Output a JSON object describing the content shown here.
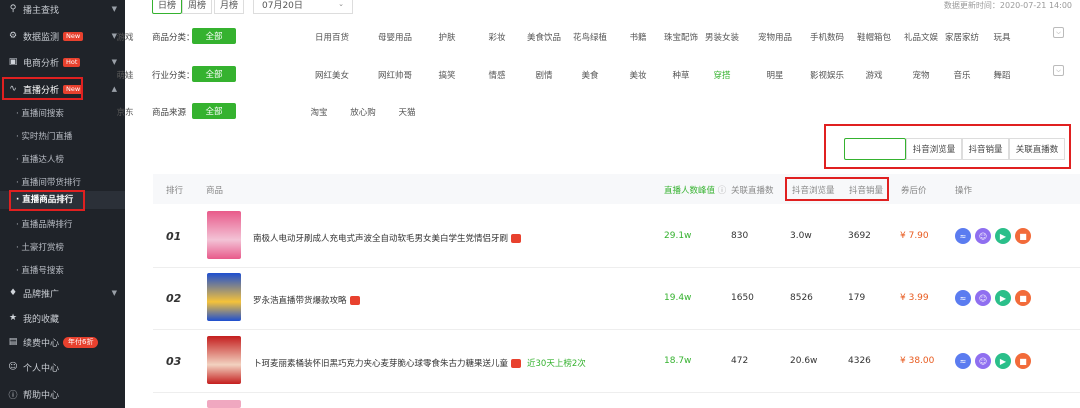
{
  "sidebar": {
    "items": [
      {
        "icon": "search-icon",
        "label": "播主查找",
        "badge": ""
      },
      {
        "icon": "monitor-icon",
        "label": "数据监测",
        "badge": "New"
      },
      {
        "icon": "shop-icon",
        "label": "电商分析",
        "badge": "Hot"
      },
      {
        "icon": "pulse-icon",
        "label": "直播分析",
        "badge": "New"
      }
    ],
    "sub_items": [
      "直播间搜索",
      "实时热门直播",
      "直播达人榜",
      "直播间带货排行",
      "直播商品排行",
      "直播品牌排行",
      "土豪打赏榜",
      "直播号搜索"
    ],
    "bottom_items": [
      {
        "icon": "diamond-icon",
        "label": "品牌推广",
        "badge": ""
      },
      {
        "icon": "star-icon",
        "label": "我的收藏",
        "badge": ""
      },
      {
        "icon": "card-icon",
        "label": "续费中心",
        "badge": "年付6折"
      },
      {
        "icon": "user-icon",
        "label": "个人中心",
        "badge": ""
      },
      {
        "icon": "help-icon",
        "label": "帮助中心",
        "badge": ""
      }
    ]
  },
  "header": {
    "tabs": [
      "日榜",
      "周榜",
      "月榜"
    ],
    "date": "07月20日",
    "update_time": "数据更新时间：2020-07-21 14:00"
  },
  "filters": {
    "category": {
      "label": "商品分类：",
      "all": "全部",
      "options": [
        "日用百货",
        "母婴用品",
        "护肤",
        "彩妆",
        "美食饮品",
        "花鸟绿植",
        "书籍",
        "珠宝配饰",
        "男装女装",
        "宠物用品",
        "手机数码",
        "鞋帽箱包",
        "礼品文娱",
        "家居家纺",
        "玩具",
        "游戏"
      ]
    },
    "industry": {
      "label": "行业分类：",
      "all": "全部",
      "options": [
        "网红美女",
        "网红帅哥",
        "搞笑",
        "情感",
        "剧情",
        "美食",
        "美妆",
        "种草",
        "穿搭",
        "明星",
        "影视娱乐",
        "游戏",
        "宠物",
        "音乐",
        "舞蹈",
        "萌娃"
      ],
      "selected": "穿搭"
    },
    "source": {
      "label": "商品来源",
      "all": "全部",
      "options": [
        "淘宝",
        "放心购",
        "天猫",
        "京东"
      ]
    }
  },
  "metrics": [
    "直播人数峰值",
    "抖音浏览量",
    "抖音销量",
    "关联直播数"
  ],
  "table": {
    "headers": [
      "排行",
      "商品",
      "直播人数峰值",
      "关联直播数",
      "抖音浏览量",
      "抖音销量",
      "券后价",
      "操作"
    ],
    "rows": [
      {
        "rank": "01",
        "name": "南极人电动牙刷成人充电式声波全自动软毛男女美白学生党情侣牙刷",
        "note": "",
        "peak": "29.1w",
        "related": "830",
        "views": "3.0w",
        "sales": "3692",
        "price": "¥ 7.90"
      },
      {
        "rank": "02",
        "name": "罗永浩直播带货爆款攻略",
        "note": "",
        "peak": "19.4w",
        "related": "1650",
        "views": "8526",
        "sales": "179",
        "price": "¥ 3.99"
      },
      {
        "rank": "03",
        "name": "卜珂麦丽素桶装怀旧黑巧克力夹心麦芽脆心球零食朱古力糖果送儿童",
        "note": "近30天上榜2次",
        "peak": "18.7w",
        "related": "472",
        "views": "20.6w",
        "sales": "4326",
        "price": "¥ 38.00"
      }
    ]
  },
  "colors": {
    "accent": "#35b22f",
    "sidebar": "#1f2329",
    "price": "#e85a1e",
    "highlight": "#e02020"
  }
}
